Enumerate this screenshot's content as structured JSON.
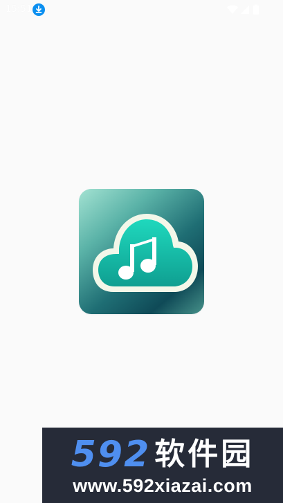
{
  "status_bar": {
    "time": "15:51",
    "download_icon": "download-icon",
    "wifi_icon": "wifi-icon",
    "signal_icon": "signal-icon",
    "battery_icon": "battery-icon"
  },
  "splash": {
    "logo_icon": "cloud-music-note-icon",
    "logo_colors": {
      "gradient_light": "#a3e2d2",
      "gradient_dark": "#0f4a57",
      "cloud_fill": "#16bda7",
      "cloud_outline": "#f3f7e9"
    }
  },
  "watermark": {
    "number": "592",
    "cn_text": "软件园",
    "url": "www.592xiazai.com",
    "number_color": "#4f8ff0",
    "bg_color": "#262b38"
  }
}
